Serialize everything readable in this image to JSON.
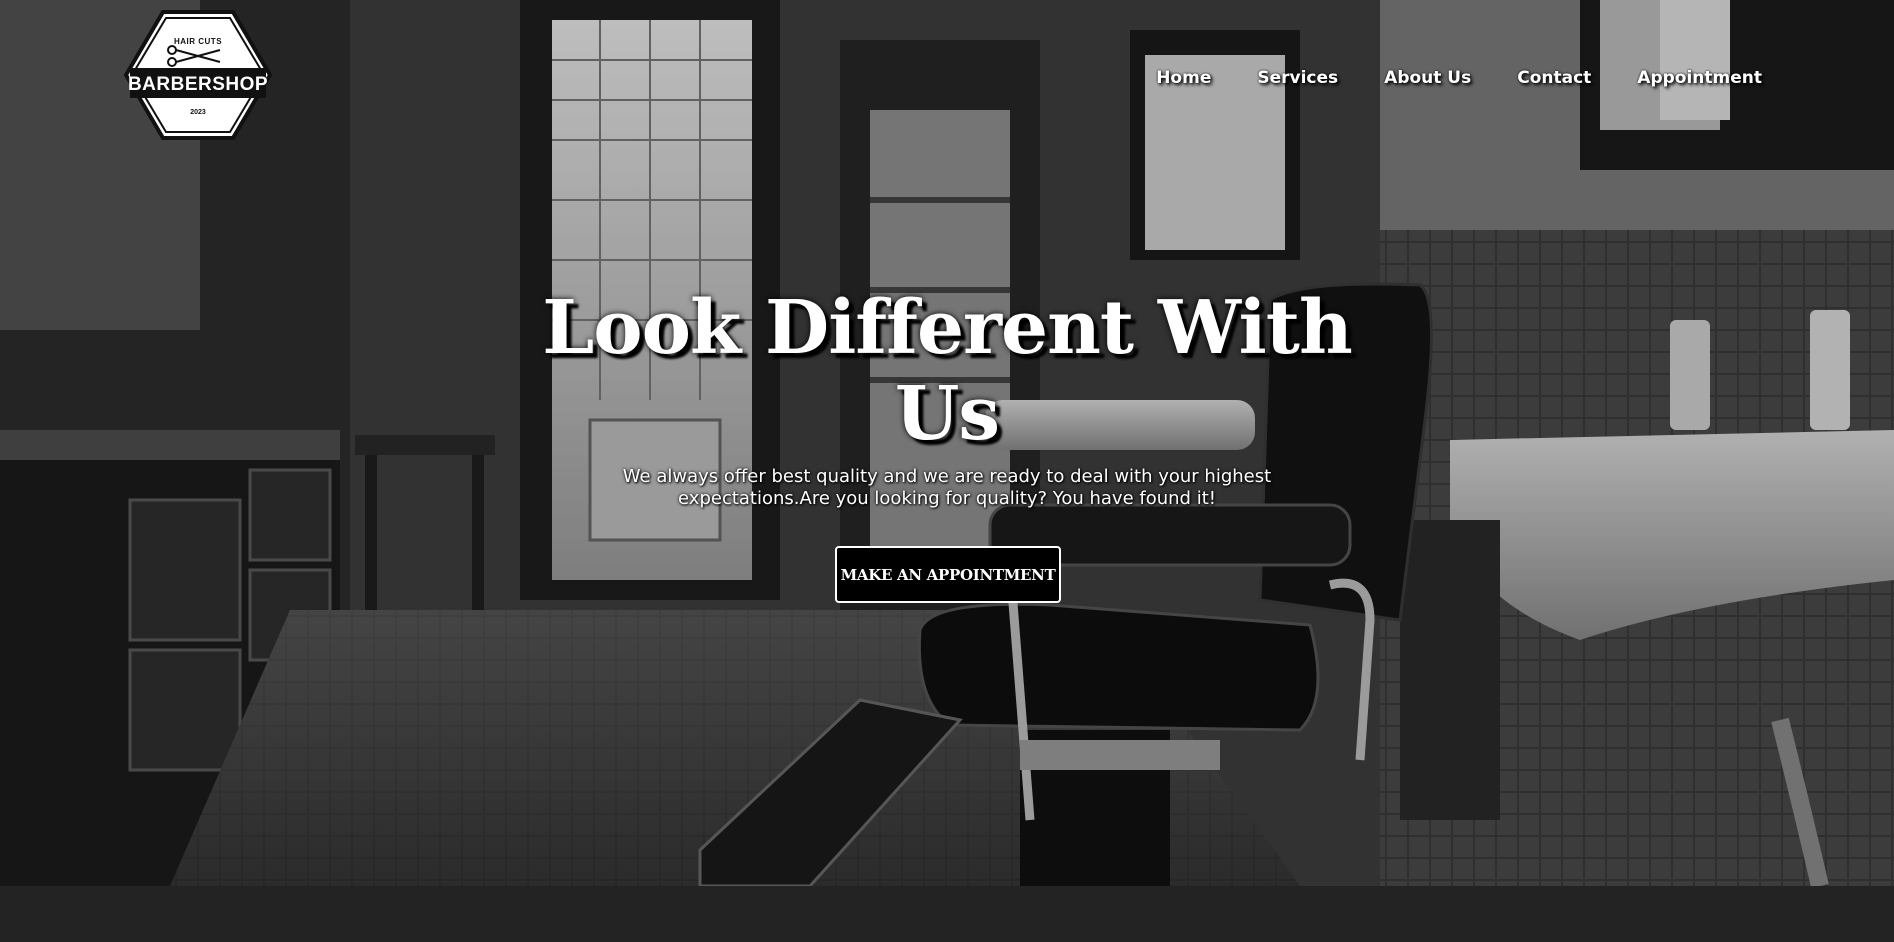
{
  "logo": {
    "top_text": "HAIR CUTS",
    "main_text": "BARBERSHOP",
    "year": "2023"
  },
  "nav": {
    "items": [
      {
        "label": "Home"
      },
      {
        "label": "Services"
      },
      {
        "label": "About Us"
      },
      {
        "label": "Contact"
      },
      {
        "label": "Appointment"
      }
    ]
  },
  "hero": {
    "headline": "Look Different With Us",
    "subtext": "We always offer best quality and we are ready to deal with your highest expectations.Are you looking for quality? You have found it!",
    "cta_label": "MAKE AN APPOINTMENT"
  },
  "colors": {
    "text": "#ffffff",
    "button_bg": "#000000",
    "footer_band": "#232323"
  }
}
